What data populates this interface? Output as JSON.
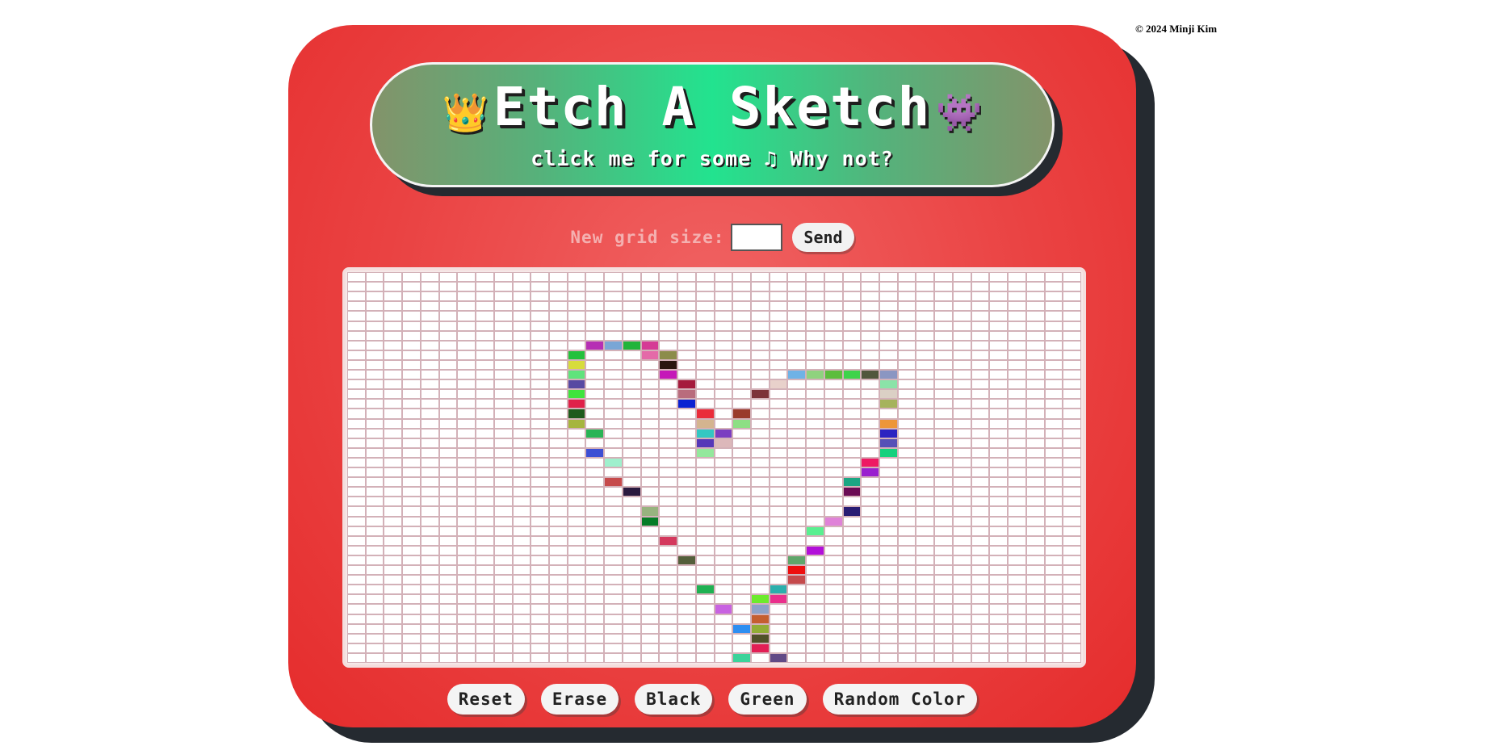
{
  "copyright": "© 2024 Minji Kim",
  "header": {
    "title": "Etch A Sketch",
    "left_emoji": "👑",
    "right_emoji": "👾",
    "subtitle_before": "click me for some",
    "subtitle_note": "♫",
    "subtitle_after": "Why not?"
  },
  "grid_form": {
    "label": "New grid size:",
    "input_value": "",
    "send_label": "Send"
  },
  "grid": {
    "size": 40,
    "default_color": "#ffffff",
    "filled_cells": [
      {
        "r": 7,
        "c": 13,
        "color": "#b62fb4"
      },
      {
        "r": 7,
        "c": 14,
        "color": "#79a6d6"
      },
      {
        "r": 7,
        "c": 15,
        "color": "#22b43b"
      },
      {
        "r": 7,
        "c": 16,
        "color": "#d53b95"
      },
      {
        "r": 8,
        "c": 12,
        "color": "#23c13c"
      },
      {
        "r": 8,
        "c": 16,
        "color": "#e46aa8"
      },
      {
        "r": 8,
        "c": 17,
        "color": "#8c8c4a"
      },
      {
        "r": 9,
        "c": 12,
        "color": "#d7dc3c"
      },
      {
        "r": 9,
        "c": 17,
        "color": "#2a170f"
      },
      {
        "r": 10,
        "c": 12,
        "color": "#5fe37c"
      },
      {
        "r": 10,
        "c": 17,
        "color": "#c519b8"
      },
      {
        "r": 10,
        "c": 24,
        "color": "#6fb2e6"
      },
      {
        "r": 10,
        "c": 25,
        "color": "#8fd27e"
      },
      {
        "r": 10,
        "c": 26,
        "color": "#5dbd3d"
      },
      {
        "r": 10,
        "c": 27,
        "color": "#3ed34a"
      },
      {
        "r": 10,
        "c": 28,
        "color": "#51573c"
      },
      {
        "r": 10,
        "c": 29,
        "color": "#8b96c2"
      },
      {
        "r": 11,
        "c": 12,
        "color": "#584aa2"
      },
      {
        "r": 11,
        "c": 18,
        "color": "#a51b3c"
      },
      {
        "r": 11,
        "c": 23,
        "color": "#e8d1cb"
      },
      {
        "r": 11,
        "c": 29,
        "color": "#8be3a8"
      },
      {
        "r": 12,
        "c": 12,
        "color": "#3ee43d"
      },
      {
        "r": 12,
        "c": 18,
        "color": "#b96c7d"
      },
      {
        "r": 12,
        "c": 22,
        "color": "#7d3239"
      },
      {
        "r": 12,
        "c": 29,
        "color": "#dbd0c5"
      },
      {
        "r": 13,
        "c": 12,
        "color": "#e02149"
      },
      {
        "r": 13,
        "c": 18,
        "color": "#0a21d2"
      },
      {
        "r": 13,
        "c": 29,
        "color": "#a6b35d"
      },
      {
        "r": 14,
        "c": 12,
        "color": "#1f5a1c"
      },
      {
        "r": 14,
        "c": 19,
        "color": "#ea2c3a"
      },
      {
        "r": 14,
        "c": 21,
        "color": "#9a3b2b"
      },
      {
        "r": 15,
        "c": 12,
        "color": "#a6b53e"
      },
      {
        "r": 15,
        "c": 19,
        "color": "#d4b48f"
      },
      {
        "r": 15,
        "c": 21,
        "color": "#8ddf84"
      },
      {
        "r": 15,
        "c": 29,
        "color": "#ed9639"
      },
      {
        "r": 16,
        "c": 13,
        "color": "#29b455"
      },
      {
        "r": 16,
        "c": 19,
        "color": "#33c7c2"
      },
      {
        "r": 16,
        "c": 20,
        "color": "#7b3ec1"
      },
      {
        "r": 16,
        "c": 29,
        "color": "#2b23c1"
      },
      {
        "r": 17,
        "c": 19,
        "color": "#5537b8"
      },
      {
        "r": 17,
        "c": 20,
        "color": "#dcb8ba"
      },
      {
        "r": 17,
        "c": 29,
        "color": "#5650b7"
      },
      {
        "r": 18,
        "c": 13,
        "color": "#3d4fd4"
      },
      {
        "r": 18,
        "c": 19,
        "color": "#93e89c"
      },
      {
        "r": 18,
        "c": 29,
        "color": "#15d17d"
      },
      {
        "r": 19,
        "c": 14,
        "color": "#9ff0cd"
      },
      {
        "r": 19,
        "c": 28,
        "color": "#ee1a63"
      },
      {
        "r": 20,
        "c": 28,
        "color": "#9a20cf"
      },
      {
        "r": 21,
        "c": 14,
        "color": "#c64a4b"
      },
      {
        "r": 21,
        "c": 27,
        "color": "#1ba683"
      },
      {
        "r": 22,
        "c": 15,
        "color": "#2a1a3f"
      },
      {
        "r": 22,
        "c": 27,
        "color": "#6b0b54"
      },
      {
        "r": 24,
        "c": 16,
        "color": "#97b37f"
      },
      {
        "r": 24,
        "c": 27,
        "color": "#281c73"
      },
      {
        "r": 25,
        "c": 16,
        "color": "#067c27"
      },
      {
        "r": 25,
        "c": 26,
        "color": "#df82d8"
      },
      {
        "r": 26,
        "c": 25,
        "color": "#59ef90"
      },
      {
        "r": 27,
        "c": 17,
        "color": "#d4385d"
      },
      {
        "r": 28,
        "c": 25,
        "color": "#b20fd9"
      },
      {
        "r": 29,
        "c": 18,
        "color": "#545f3b"
      },
      {
        "r": 29,
        "c": 24,
        "color": "#5fa66a"
      },
      {
        "r": 30,
        "c": 24,
        "color": "#ee0e0e"
      },
      {
        "r": 31,
        "c": 24,
        "color": "#c54a4c"
      },
      {
        "r": 32,
        "c": 19,
        "color": "#1fb152"
      },
      {
        "r": 32,
        "c": 23,
        "color": "#2bafac"
      },
      {
        "r": 33,
        "c": 22,
        "color": "#6ceb2c"
      },
      {
        "r": 33,
        "c": 23,
        "color": "#ea2f8c"
      },
      {
        "r": 34,
        "c": 20,
        "color": "#c862e1"
      },
      {
        "r": 34,
        "c": 22,
        "color": "#8da1c8"
      },
      {
        "r": 35,
        "c": 22,
        "color": "#c55e30"
      },
      {
        "r": 36,
        "c": 21,
        "color": "#2d8ef1"
      },
      {
        "r": 36,
        "c": 22,
        "color": "#92ad35"
      },
      {
        "r": 37,
        "c": 22,
        "color": "#51512a"
      },
      {
        "r": 38,
        "c": 22,
        "color": "#e21e55"
      },
      {
        "r": 39,
        "c": 21,
        "color": "#3bd39a"
      },
      {
        "r": 39,
        "c": 23,
        "color": "#614a86"
      }
    ]
  },
  "controls": {
    "reset": "Reset",
    "erase": "Erase",
    "black": "Black",
    "green": "Green",
    "random": "Random Color"
  },
  "colors": {
    "console": "#e52c2c",
    "shadow": "#252a30",
    "banner_center": "#22e38f",
    "banner_edge": "#83936a"
  }
}
